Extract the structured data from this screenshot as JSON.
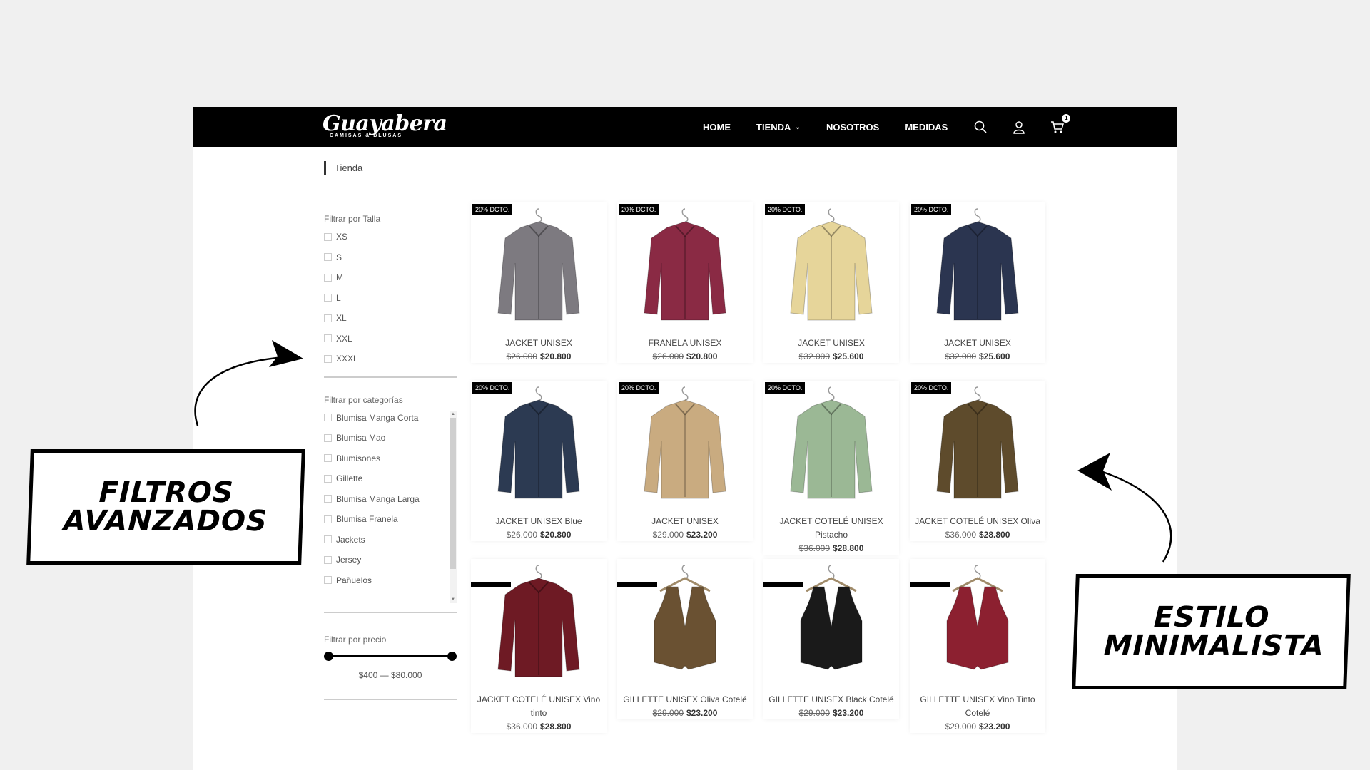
{
  "header": {
    "logo_main": "Guayabera",
    "logo_sub": "CAMISAS & BLUSAS",
    "nav": [
      "HOME",
      "TIENDA",
      "NOSOTROS",
      "MEDIDAS"
    ],
    "cart_count": "1",
    "icons": [
      "search-icon",
      "user-icon",
      "cart-icon"
    ]
  },
  "breadcrumb": "Tienda",
  "filters": {
    "size_title": "Filtrar por Talla",
    "sizes": [
      "XS",
      "S",
      "M",
      "L",
      "XL",
      "XXL",
      "XXXL"
    ],
    "category_title": "Filtrar por categorías",
    "categories": [
      "Blumisa Manga Corta",
      "Blumisa Mao",
      "Blumisones",
      "Gillette",
      "Blumisa Manga Larga",
      "Blumisa Franela",
      "Jackets",
      "Jersey",
      "Pañuelos"
    ],
    "price_title": "Filtrar por precio",
    "price_range": "$400 — $80.000"
  },
  "badge_text": "20% DCTO.",
  "products": [
    {
      "name": "JACKET UNISEX",
      "old": "$26.000",
      "new": "$20.800",
      "badge": true,
      "color": "#7d7a80",
      "kind": "shirt"
    },
    {
      "name": "FRANELA UNISEX",
      "old": "$26.000",
      "new": "$20.800",
      "badge": true,
      "color": "#8a2a44",
      "kind": "shirt"
    },
    {
      "name": "JACKET UNISEX",
      "old": "$32.000",
      "new": "$25.600",
      "badge": true,
      "color": "#e6d59a",
      "kind": "shirt"
    },
    {
      "name": "JACKET UNISEX",
      "old": "$32.000",
      "new": "$25.600",
      "badge": true,
      "color": "#2b3550",
      "kind": "shirt"
    },
    {
      "name": "JACKET UNISEX Blue",
      "old": "$26.000",
      "new": "$20.800",
      "badge": true,
      "color": "#2c3a52",
      "kind": "shirt"
    },
    {
      "name": "JACKET UNISEX",
      "old": "$29.000",
      "new": "$23.200",
      "badge": true,
      "color": "#c9ab80",
      "kind": "shirt"
    },
    {
      "name": "JACKET COTELÉ UNISEX Pistacho",
      "old": "$36.000",
      "new": "$28.800",
      "badge": true,
      "color": "#9bb895",
      "kind": "shirt"
    },
    {
      "name": "JACKET COTELÉ UNISEX Oliva",
      "old": "$36.000",
      "new": "$28.800",
      "badge": true,
      "color": "#5e4b2c",
      "kind": "shirt"
    },
    {
      "name": "JACKET COTELÉ UNISEX Vino tinto",
      "old": "$36.000",
      "new": "$28.800",
      "badge": false,
      "color": "#6e1a24",
      "kind": "shirt"
    },
    {
      "name": "GILLETTE UNISEX Oliva Cotelé",
      "old": "$29.000",
      "new": "$23.200",
      "badge": false,
      "color": "#6a5132",
      "kind": "vest"
    },
    {
      "name": "GILLETTE UNISEX Black Cotelé",
      "old": "$29.000",
      "new": "$23.200",
      "badge": false,
      "color": "#1a1a1a",
      "kind": "vest"
    },
    {
      "name": "GILLETTE UNISEX Vino Tinto Cotelé",
      "old": "$29.000",
      "new": "$23.200",
      "badge": false,
      "color": "#8c2030",
      "kind": "vest"
    }
  ],
  "annotations": {
    "left": "FILTROS AVANZADOS",
    "right": "ESTILO MINIMALISTA"
  }
}
